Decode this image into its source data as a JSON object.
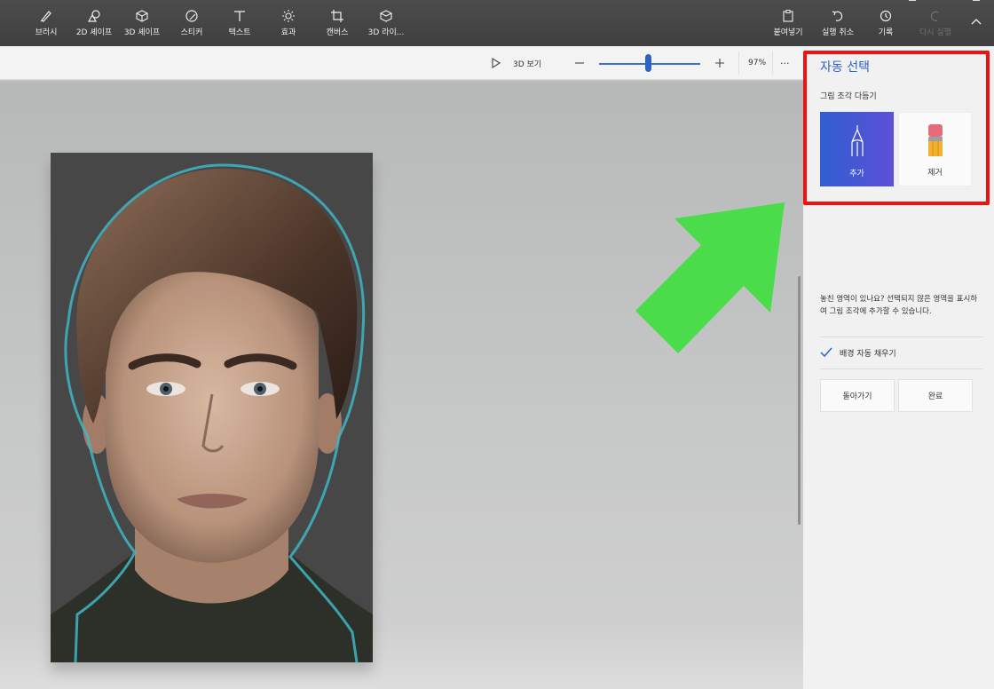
{
  "toolbar": {
    "tools": [
      {
        "label": "브러시",
        "icon": "brush-icon"
      },
      {
        "label": "2D 셰이프",
        "icon": "2d-shapes-icon"
      },
      {
        "label": "3D 셰이프",
        "icon": "3d-shapes-icon"
      },
      {
        "label": "스티커",
        "icon": "sticker-icon"
      },
      {
        "label": "텍스트",
        "icon": "text-icon"
      },
      {
        "label": "효과",
        "icon": "effects-icon"
      },
      {
        "label": "캔버스",
        "icon": "canvas-icon"
      },
      {
        "label": "3D 라이...",
        "icon": "3d-library-icon"
      }
    ],
    "actions": [
      {
        "label": "붙여넣기",
        "icon": "paste-icon"
      },
      {
        "label": "실행 취소",
        "icon": "undo-icon"
      },
      {
        "label": "기록",
        "icon": "history-icon"
      },
      {
        "label": "다시 실행",
        "icon": "redo-icon"
      }
    ]
  },
  "viewbar": {
    "view3d_label": "3D 보기",
    "zoom_percent": "97%",
    "zoom_level": 0.49,
    "more": "···"
  },
  "panel": {
    "title": "자동 선택",
    "subtitle": "그림 조각 다듬기",
    "add_label": "추가",
    "remove_label": "제거",
    "help_text": "놓친 영역이 있나요? 선택되지 않은 영역을 표시하여 그림 조각에 추가할 수 있습니다.",
    "autofill_label": "배경 자동 채우기",
    "autofill_checked": true,
    "back_label": "돌아가기",
    "done_label": "완료"
  },
  "colors": {
    "accent": "#2e63c7",
    "highlight_box": "#ee1111",
    "arrow": "#4bdc4b",
    "selection_outline": "#3fb6c6"
  }
}
